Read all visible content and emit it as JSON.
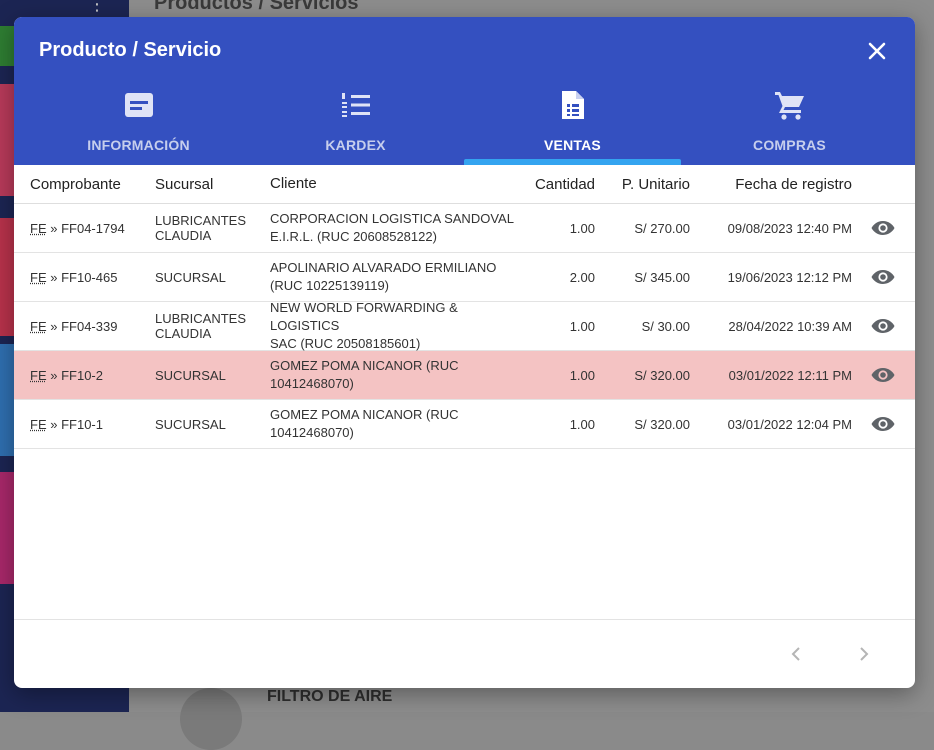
{
  "background": {
    "page_title": "Productos / Servicios",
    "item_name": "FILTRO DE AIRE"
  },
  "modal": {
    "title": "Producto / Servicio",
    "close_icon": "close-icon",
    "tabs": [
      {
        "label": "INFORMACIÓN",
        "icon": "card-text-icon",
        "active": false
      },
      {
        "label": "KARDEX",
        "icon": "list-numbered-icon",
        "active": false
      },
      {
        "label": "VENTAS",
        "icon": "document-icon",
        "active": true
      },
      {
        "label": "COMPRAS",
        "icon": "cart-icon",
        "active": false
      }
    ],
    "table": {
      "headers": [
        "Comprobante",
        "Sucursal",
        "Cliente",
        "Cantidad",
        "P. Unitario",
        "Fecha de registro"
      ],
      "rows": [
        {
          "doc_type": "FE",
          "doc_number": "» FF04-1794",
          "branch_1": "LUBRICANTES",
          "branch_2": "CLAUDIA",
          "client_1": "CORPORACION LOGISTICA SANDOVAL",
          "client_2": "E.I.R.L. (RUC 20608528122)",
          "qty": "1.00",
          "price": "S/ 270.00",
          "date": "09/08/2023 12:40 PM",
          "highlight": false
        },
        {
          "doc_type": "FE",
          "doc_number": "» FF10-465",
          "branch_1": "SUCURSAL",
          "branch_2": "",
          "client_1": "APOLINARIO ALVARADO ERMILIANO",
          "client_2": "(RUC 10225139119)",
          "qty": "2.00",
          "price": "S/ 345.00",
          "date": "19/06/2023 12:12 PM",
          "highlight": false
        },
        {
          "doc_type": "FE",
          "doc_number": "» FF04-339",
          "branch_1": "LUBRICANTES",
          "branch_2": "CLAUDIA",
          "client_1": "NEW WORLD FORWARDING & LOGISTICS",
          "client_2": "SAC (RUC 20508185601)",
          "qty": "1.00",
          "price": "S/ 30.00",
          "date": "28/04/2022 10:39 AM",
          "highlight": false
        },
        {
          "doc_type": "FE",
          "doc_number": "» FF10-2",
          "branch_1": "SUCURSAL",
          "branch_2": "",
          "client_1": "GOMEZ POMA NICANOR (RUC",
          "client_2": "10412468070)",
          "qty": "1.00",
          "price": "S/ 320.00",
          "date": "03/01/2022 12:11 PM",
          "highlight": true
        },
        {
          "doc_type": "FE",
          "doc_number": "» FF10-1",
          "branch_1": "SUCURSAL",
          "branch_2": "",
          "client_1": "GOMEZ POMA NICANOR (RUC",
          "client_2": "10412468070)",
          "qty": "1.00",
          "price": "S/ 320.00",
          "date": "03/01/2022 12:04 PM",
          "highlight": false
        }
      ]
    }
  },
  "colors": {
    "header_bg": "#3450c0",
    "ink_bar": "#34a4f0",
    "highlight_row": "#f4c3c3"
  }
}
